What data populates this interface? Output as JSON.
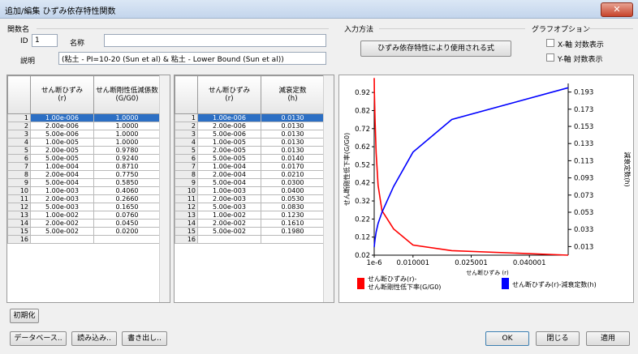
{
  "window": {
    "title": "追加/編集 ひずみ依存特性関数",
    "close_glyph": "✕"
  },
  "relation": {
    "group_label": "関数名",
    "id_label": "ID",
    "id_value": "1",
    "name_label": "名称",
    "name_value": "",
    "desc_label": "説明",
    "desc_value": "(粘土 - PI=10-20 (Sun et al) & 粘土 - Lower Bound (Sun et al))"
  },
  "input_method": {
    "group_label": "入力方法",
    "button_label": "ひずみ依存特性により使用される式"
  },
  "graph_options": {
    "group_label": "グラフオプション",
    "x_log_label": "X-軸 対数表示",
    "y_log_label": "Y-軸 対数表示"
  },
  "table_left": {
    "col1_header": "せん断ひずみ\n(r)",
    "col2_header": "せん断剛性低減係数\n(G/G0)",
    "row_numbers": [
      "1",
      "2",
      "3",
      "4",
      "5",
      "6",
      "7",
      "8",
      "9",
      "10",
      "11",
      "12",
      "13",
      "14",
      "15",
      "16"
    ],
    "col1": [
      "1.00e-006",
      "2.00e-006",
      "5.00e-006",
      "1.00e-005",
      "2.00e-005",
      "5.00e-005",
      "1.00e-004",
      "2.00e-004",
      "5.00e-004",
      "1.00e-003",
      "2.00e-003",
      "5.00e-003",
      "1.00e-002",
      "2.00e-002",
      "5.00e-002",
      ""
    ],
    "col2": [
      "1.0000",
      "1.0000",
      "1.0000",
      "1.0000",
      "0.9780",
      "0.9240",
      "0.8710",
      "0.7750",
      "0.5850",
      "0.4060",
      "0.2660",
      "0.1650",
      "0.0760",
      "0.0450",
      "0.0200",
      ""
    ]
  },
  "table_right": {
    "col1_header": "せん断ひずみ\n(r)",
    "col2_header": "減衰定数\n(h)",
    "row_numbers": [
      "1",
      "2",
      "3",
      "4",
      "5",
      "6",
      "7",
      "8",
      "9",
      "10",
      "11",
      "12",
      "13",
      "14",
      "15",
      "16"
    ],
    "col1": [
      "1.00e-006",
      "2.00e-006",
      "5.00e-006",
      "1.00e-005",
      "2.00e-005",
      "5.00e-005",
      "1.00e-004",
      "2.00e-004",
      "5.00e-004",
      "1.00e-003",
      "2.00e-003",
      "5.00e-003",
      "1.00e-002",
      "2.00e-002",
      "5.00e-002",
      ""
    ],
    "col2": [
      "0.0130",
      "0.0130",
      "0.0130",
      "0.0130",
      "0.0130",
      "0.0140",
      "0.0170",
      "0.0210",
      "0.0300",
      "0.0400",
      "0.0530",
      "0.0830",
      "0.1230",
      "0.1610",
      "0.1980",
      ""
    ]
  },
  "buttons": {
    "initialize": "初期化",
    "database": "データベース..",
    "load": "読み込み..",
    "export": "書き出し..",
    "ok": "OK",
    "close": "閉じる",
    "apply": "適用"
  },
  "chart_data": {
    "type": "line",
    "xlabel": "せん断ひずみ (r)",
    "ylabel_left": "せん断剛性低下率(G/G0)",
    "ylabel_right": "減衰定数(h)",
    "xlim": [
      0,
      0.05
    ],
    "ylim_left": [
      0.02,
      0.97
    ],
    "ylim_right": [
      0.003,
      0.203
    ],
    "x_ticks": [
      "1e-6",
      "0.010001",
      "0.025001",
      "0.040001"
    ],
    "x_tick_values": [
      1e-06,
      0.010001,
      0.025001,
      0.040001
    ],
    "y_ticks_left": [
      "0.92",
      "0.82",
      "0.72",
      "0.62",
      "0.52",
      "0.42",
      "0.32",
      "0.22",
      "0.12",
      "0.02"
    ],
    "y_ticks_right": [
      "0.193",
      "0.173",
      "0.153",
      "0.133",
      "0.113",
      "0.093",
      "0.073",
      "0.053",
      "0.033",
      "0.013"
    ],
    "x_log": false,
    "y_log": false,
    "grid": false,
    "legend_position": "bottom",
    "series": [
      {
        "name": "せん断ひずみ(r)- せん断剛性低下率(G/G0)",
        "axis": "left",
        "color": "#ff0000",
        "x": [
          1e-06,
          2e-06,
          5e-06,
          1e-05,
          2e-05,
          5e-05,
          0.0001,
          0.0002,
          0.0005,
          0.001,
          0.002,
          0.005,
          0.01,
          0.02,
          0.05
        ],
        "y": [
          1.0,
          1.0,
          1.0,
          1.0,
          0.978,
          0.924,
          0.871,
          0.775,
          0.585,
          0.406,
          0.266,
          0.165,
          0.076,
          0.045,
          0.02
        ]
      },
      {
        "name": "せん断ひずみ(r)-減衰定数(h)",
        "axis": "right",
        "color": "#0000ff",
        "x": [
          1e-06,
          2e-06,
          5e-06,
          1e-05,
          2e-05,
          5e-05,
          0.0001,
          0.0002,
          0.0005,
          0.001,
          0.002,
          0.005,
          0.01,
          0.02,
          0.05
        ],
        "y": [
          0.013,
          0.013,
          0.013,
          0.013,
          0.013,
          0.014,
          0.017,
          0.021,
          0.03,
          0.04,
          0.053,
          0.083,
          0.123,
          0.161,
          0.198
        ]
      }
    ]
  }
}
